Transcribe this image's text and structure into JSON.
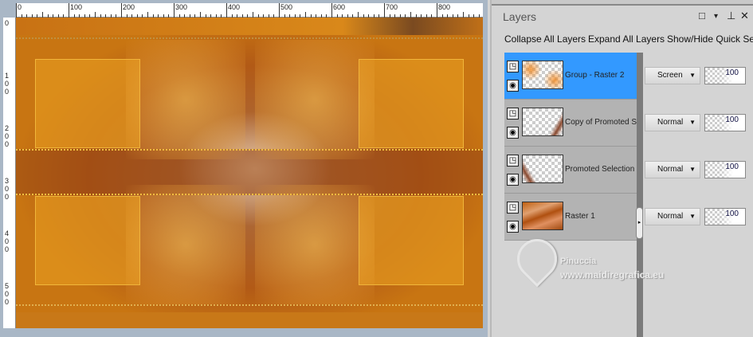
{
  "ruler": {
    "h_labels": [
      "0",
      "100",
      "200",
      "300",
      "400",
      "500",
      "600",
      "700",
      "800"
    ],
    "v_labels": [
      "0",
      "100",
      "200",
      "300",
      "400",
      "500"
    ]
  },
  "panel": {
    "title": "Layers",
    "window_buttons": {
      "restore": "□",
      "menu": "▾",
      "pin": "⊥",
      "close": "✕"
    },
    "toolbar": [
      "Collapse All Layers",
      "Expand All Layers",
      "Show/Hide Quick Se"
    ],
    "layers": [
      {
        "name": "Group - Raster 2",
        "blend": "Screen",
        "opacity": "100",
        "selected": true
      },
      {
        "name": "Copy of Promoted Sele",
        "blend": "Normal",
        "opacity": "100",
        "selected": false
      },
      {
        "name": "Promoted Selection",
        "blend": "Normal",
        "opacity": "100",
        "selected": false
      },
      {
        "name": "Raster 1",
        "blend": "Normal",
        "opacity": "100",
        "selected": false
      }
    ],
    "selected_color": "#3399ff"
  },
  "watermark": {
    "line1": "Pinuccia",
    "line2": "www.maidiregrafica.eu"
  }
}
